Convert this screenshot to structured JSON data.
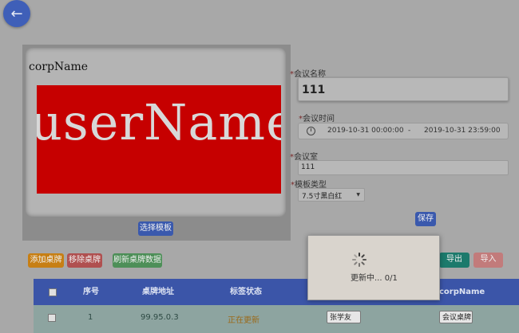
{
  "nav": {
    "back_icon": "arrow-left-icon",
    "back_glyph": "←"
  },
  "preview": {
    "corp_name": "corpName",
    "user_name": "userName",
    "select_template_label": "选择模板",
    "badge_color": "#c60000"
  },
  "form": {
    "meeting_name_label": "会议名称",
    "meeting_name_value": "111",
    "meeting_time_label": "会议时间",
    "start_time": "2019-10-31 00:00:00",
    "range_separator": "-",
    "end_time": "2019-10-31 23:59:00",
    "meeting_room_label": "会议室",
    "meeting_room_value": "111",
    "template_type_label": "模板类型",
    "template_type_value": "7.5寸黑白红",
    "required_mark": "*",
    "save_label": "保存"
  },
  "toolbar": {
    "add_label": "添加桌牌",
    "remove_label": "移除桌牌",
    "refresh_label": "刷新桌牌数据",
    "export_label": "导出",
    "import_label": "导入"
  },
  "table": {
    "headers": {
      "index": "序号",
      "address": "桌牌地址",
      "tag_status": "标签状态",
      "corp_name": "corpName"
    },
    "rows": [
      {
        "index": "1",
        "address": "99.95.0.3",
        "status": "正在更新",
        "user_name": "张学友",
        "corp_name": "会议桌牌"
      }
    ]
  },
  "loading": {
    "text": "更新中... 0/1"
  },
  "colors": {
    "primary": "#3a59ad",
    "warning": "#c77f14",
    "danger": "#b05050",
    "success": "#4d8f58",
    "teal": "#1c7a6c"
  }
}
